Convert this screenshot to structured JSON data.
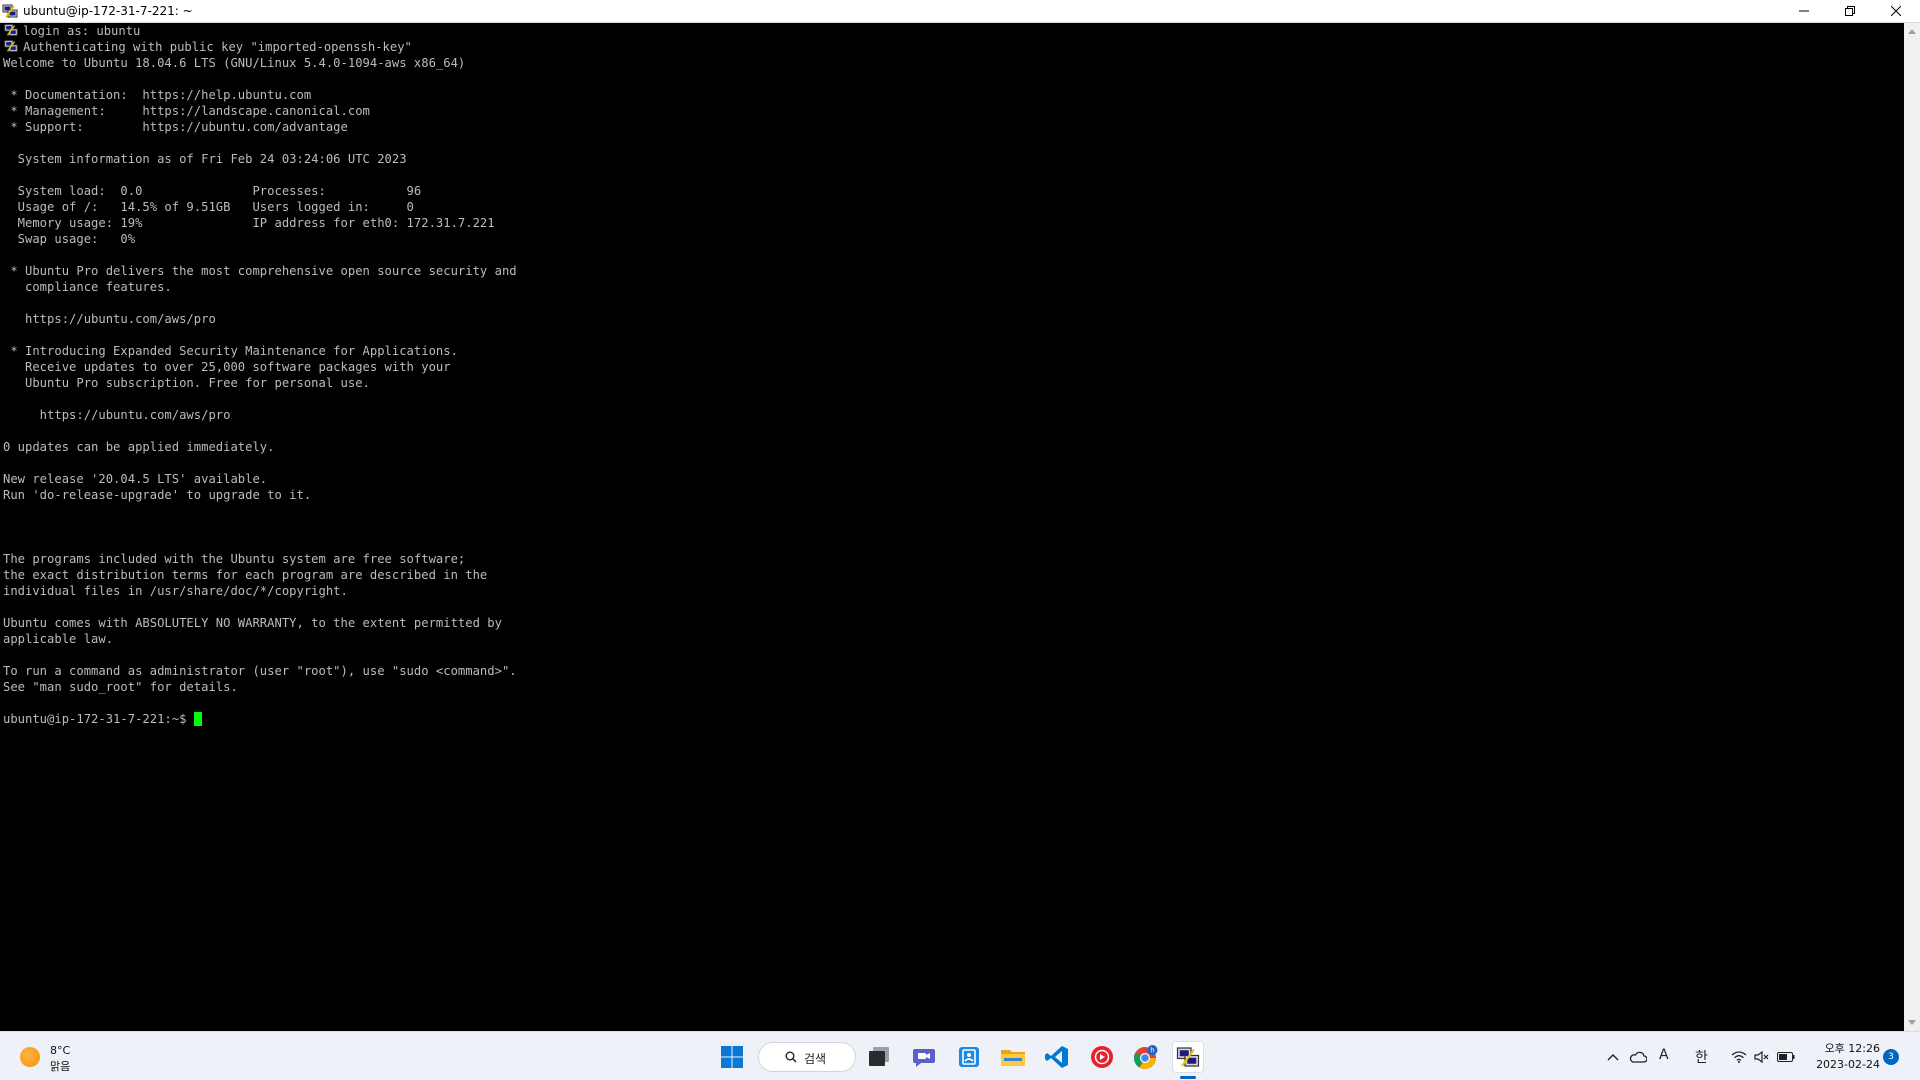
{
  "window": {
    "title": "ubuntu@ip-172-31-7-221: ~"
  },
  "terminal": {
    "lines": [
      "login as: ubuntu",
      "Authenticating with public key \"imported-openssh-key\"",
      "Welcome to Ubuntu 18.04.6 LTS (GNU/Linux 5.4.0-1094-aws x86_64)",
      "",
      " * Documentation:  https://help.ubuntu.com",
      " * Management:     https://landscape.canonical.com",
      " * Support:        https://ubuntu.com/advantage",
      "",
      "  System information as of Fri Feb 24 03:24:06 UTC 2023",
      "",
      "  System load:  0.0               Processes:           96",
      "  Usage of /:   14.5% of 9.51GB   Users logged in:     0",
      "  Memory usage: 19%               IP address for eth0: 172.31.7.221",
      "  Swap usage:   0%",
      "",
      " * Ubuntu Pro delivers the most comprehensive open source security and",
      "   compliance features.",
      "",
      "   https://ubuntu.com/aws/pro",
      "",
      " * Introducing Expanded Security Maintenance for Applications.",
      "   Receive updates to over 25,000 software packages with your",
      "   Ubuntu Pro subscription. Free for personal use.",
      "",
      "     https://ubuntu.com/aws/pro",
      "",
      "0 updates can be applied immediately.",
      "",
      "New release '20.04.5 LTS' available.",
      "Run 'do-release-upgrade' to upgrade to it.",
      "",
      "",
      "",
      "The programs included with the Ubuntu system are free software;",
      "the exact distribution terms for each program are described in the",
      "individual files in /usr/share/doc/*/copyright.",
      "",
      "Ubuntu comes with ABSOLUTELY NO WARRANTY, to the extent permitted by",
      "applicable law.",
      "",
      "To run a command as administrator (user \"root\"), use \"sudo <command>\".",
      "See \"man sudo_root\" for details.",
      ""
    ],
    "prompt": "ubuntu@ip-172-31-7-221:~$",
    "cursor_color": "#00ff00"
  },
  "taskbar": {
    "weather": {
      "temp": "8°C",
      "condition": "맑음"
    },
    "search_label": "검색",
    "chrome_badge": "h",
    "tray": {
      "ime_a": "A",
      "ime_lang": "한"
    },
    "clock": {
      "time": "오후 12:26",
      "date": "2023-02-24"
    },
    "notifications": "3"
  }
}
